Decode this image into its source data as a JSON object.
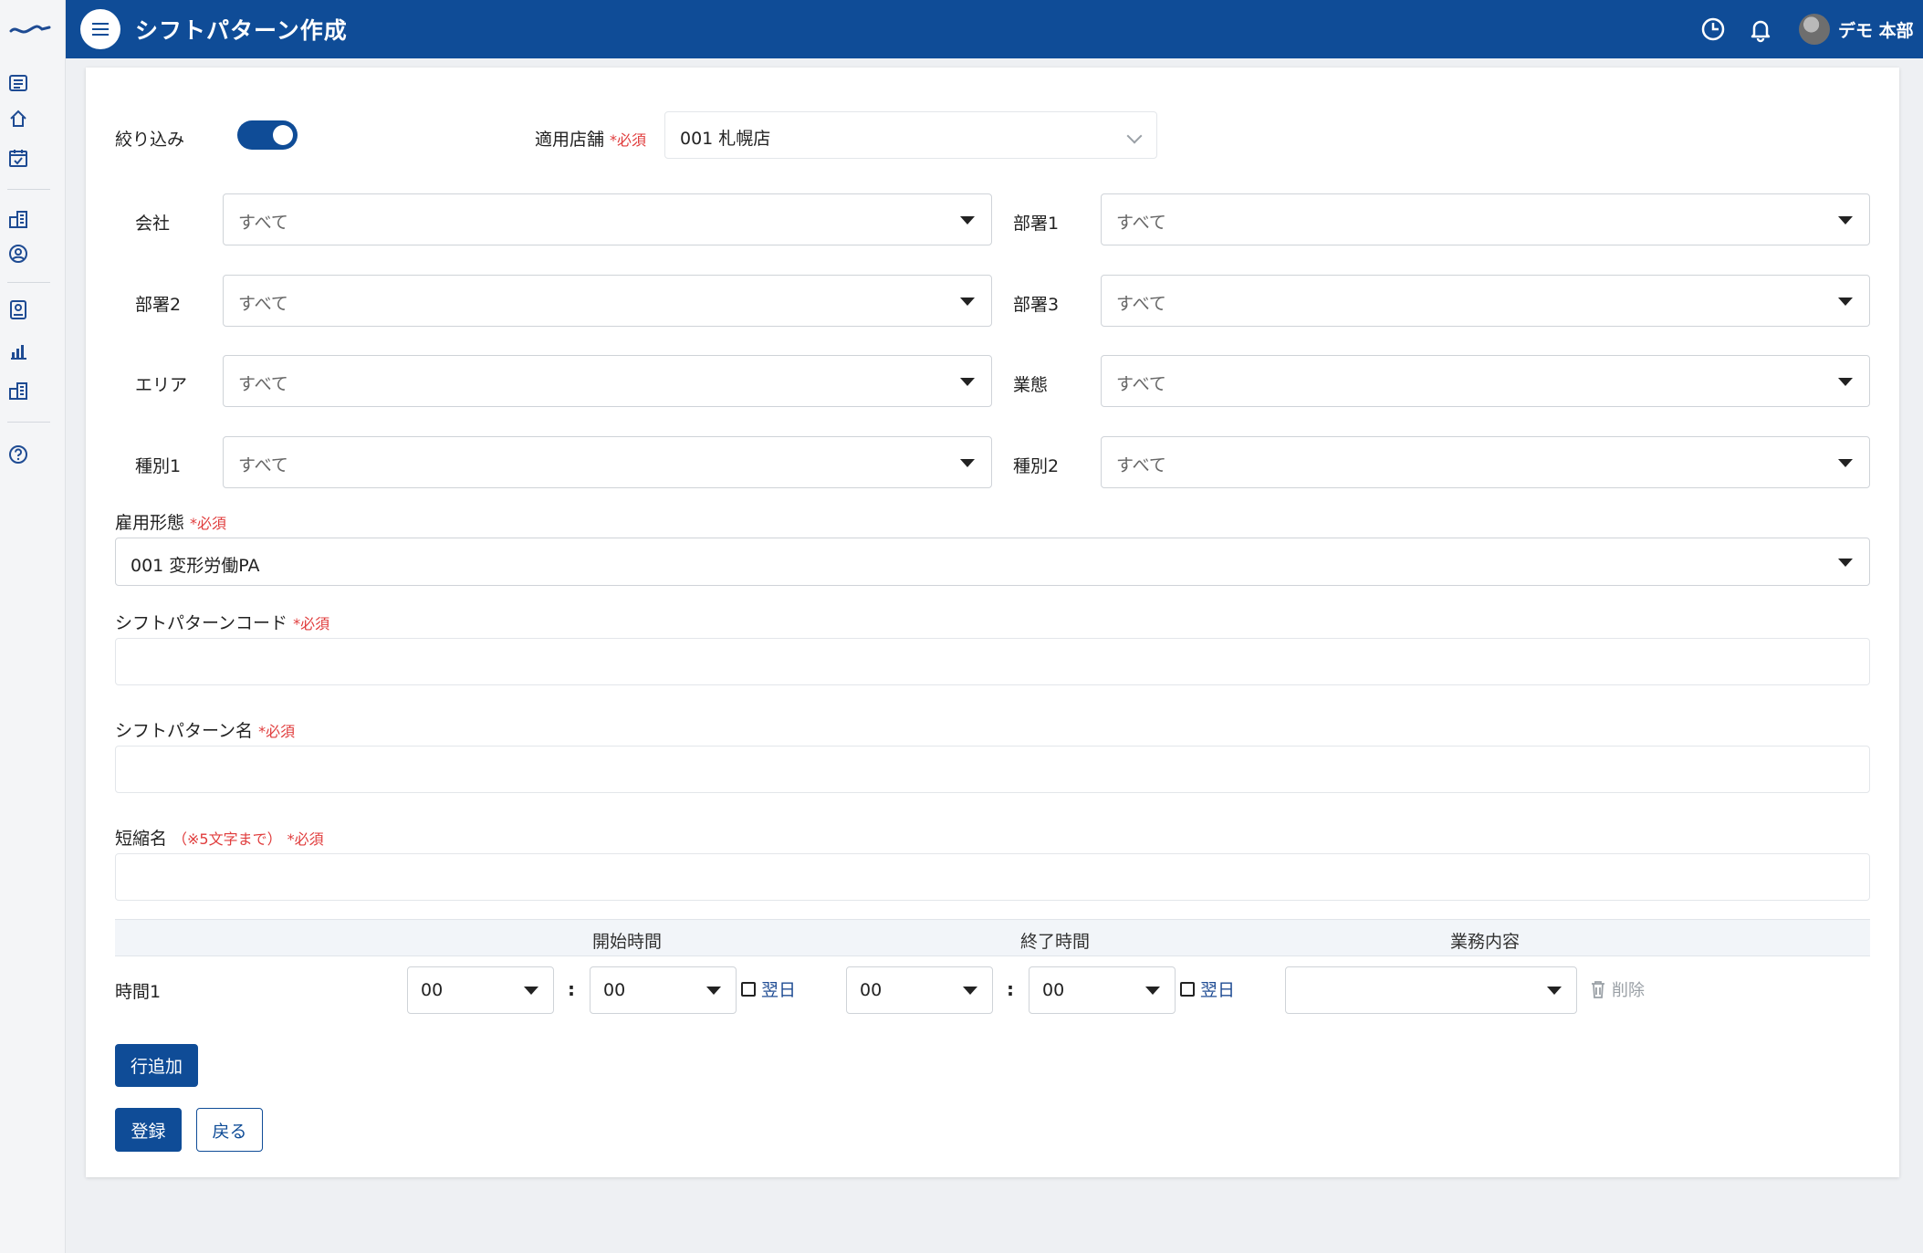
{
  "header": {
    "title": "シフトパターン作成",
    "user_name": "デモ 本部",
    "icons": [
      "menu-icon",
      "clock-icon",
      "bell-icon",
      "avatar"
    ]
  },
  "sidebar": {
    "icons": [
      "logo",
      "list-icon",
      "home-icon",
      "calendar-check-icon",
      "building-icon",
      "user-circle-icon",
      "id-badge-icon",
      "bar-chart-icon",
      "building-icon",
      "help-icon"
    ]
  },
  "form": {
    "filter_label": "絞り込み",
    "filter_enabled": true,
    "store_label": "適用店舗",
    "store_value": "001 札幌店",
    "required_mark": "*必須",
    "filters": [
      {
        "label": "会社",
        "value": "すべて"
      },
      {
        "label": "部署1",
        "value": "すべて"
      },
      {
        "label": "部署2",
        "value": "すべて"
      },
      {
        "label": "部署3",
        "value": "すべて"
      },
      {
        "label": "エリア",
        "value": "すべて"
      },
      {
        "label": "業態",
        "value": "すべて"
      },
      {
        "label": "種別1",
        "value": "すべて"
      },
      {
        "label": "種別2",
        "value": "すべて"
      }
    ],
    "employment_label": "雇用形態",
    "employment_value": "001 変形労働PA",
    "code_label": "シフトパターンコード",
    "code_value": "",
    "name_label": "シフトパターン名",
    "name_value": "",
    "short_label": "短縮名",
    "short_note": "（※5文字まで）",
    "short_value": ""
  },
  "time_table": {
    "headers": {
      "start": "開始時間",
      "end": "終了時間",
      "task": "業務内容"
    },
    "rows": [
      {
        "label": "時間1",
        "start_hour": "00",
        "start_min": "00",
        "start_next_day": "翌日",
        "end_hour": "00",
        "end_min": "00",
        "end_next_day": "翌日",
        "task": "",
        "delete_label": "削除"
      }
    ],
    "colon": ":"
  },
  "buttons": {
    "add_row": "行追加",
    "register": "登録",
    "back": "戻る"
  },
  "colors": {
    "primary": "#0f4c97",
    "required": "#e03c3c"
  }
}
